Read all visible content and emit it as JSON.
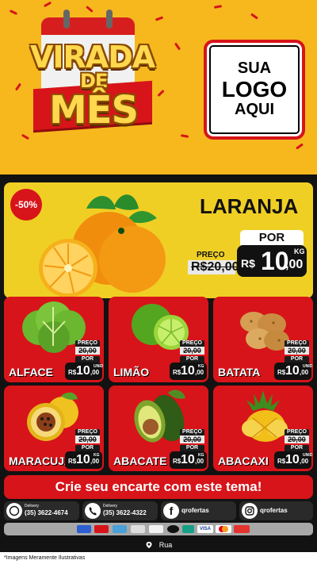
{
  "header": {
    "title_line1": "VIRADA",
    "title_line2": "DE",
    "title_line3": "MÊS",
    "logo_line1": "SUA",
    "logo_line2": "LOGO",
    "logo_line3": "AQUI",
    "colors": {
      "background": "#f6b81d",
      "red": "#d7141a",
      "gold": "#ffd84d"
    }
  },
  "featured": {
    "discount": "-50%",
    "name": "LARANJA",
    "old_label": "PREÇO",
    "old_price": "R$20,00",
    "new_label": "POR",
    "currency": "R$",
    "new_price_int": "10",
    "new_price_cents": ",00",
    "unit": "KG",
    "image": "orange-fruits-image"
  },
  "products": [
    {
      "name": "ALFACE",
      "old_label": "PREÇO",
      "old_price": "20,00",
      "new_label": "POR",
      "currency": "R$",
      "new_price_int": "10",
      "new_price_cents": ",00",
      "unit": "UNID",
      "image": "lettuce-image"
    },
    {
      "name": "LIMÃO",
      "old_label": "PREÇO",
      "old_price": "20,00",
      "new_label": "POR",
      "currency": "R$",
      "new_price_int": "10",
      "new_price_cents": ",00",
      "unit": "KG",
      "image": "lime-image"
    },
    {
      "name": "BATATA",
      "old_label": "PREÇO",
      "old_price": "20,00",
      "new_label": "POR",
      "currency": "R$",
      "new_price_int": "10",
      "new_price_cents": ",00",
      "unit": "UNID",
      "image": "potato-image"
    },
    {
      "name": "MARACUJÁ",
      "old_label": "PREÇO",
      "old_price": "20,00",
      "new_label": "POR",
      "currency": "R$",
      "new_price_int": "10",
      "new_price_cents": ",00",
      "unit": "KG",
      "image": "passion-fruit-image"
    },
    {
      "name": "ABACATE",
      "old_label": "PREÇO",
      "old_price": "20,00",
      "new_label": "POR",
      "currency": "R$",
      "new_price_int": "10",
      "new_price_cents": ",00",
      "unit": "KG",
      "image": "avocado-image"
    },
    {
      "name": "ABACAXI",
      "old_label": "PREÇO",
      "old_price": "20,00",
      "new_label": "POR",
      "currency": "R$",
      "new_price_int": "10",
      "new_price_cents": ",00",
      "unit": "UNID",
      "image": "pineapple-image"
    }
  ],
  "cta": {
    "label": "Crie seu encarte com este tema!"
  },
  "contacts": [
    {
      "icon": "whatsapp-icon",
      "label": "Delivery",
      "value": "(35) 3622-4674"
    },
    {
      "icon": "phone-icon",
      "label": "Delivery",
      "value": "(35) 3622-4322"
    },
    {
      "icon": "facebook-icon",
      "label": "",
      "value": "qrofertas"
    },
    {
      "icon": "instagram-icon",
      "label": "",
      "value": "qrofertas"
    }
  ],
  "payments": {
    "items": [
      "card",
      "card",
      "card",
      "card",
      "card",
      "card",
      "card",
      "VISA",
      "Mastercard",
      "card"
    ]
  },
  "address": {
    "icon": "location-pin-icon",
    "text": "Rua"
  },
  "footer": {
    "text": "*Imagens Meramente Ilustrativas"
  }
}
